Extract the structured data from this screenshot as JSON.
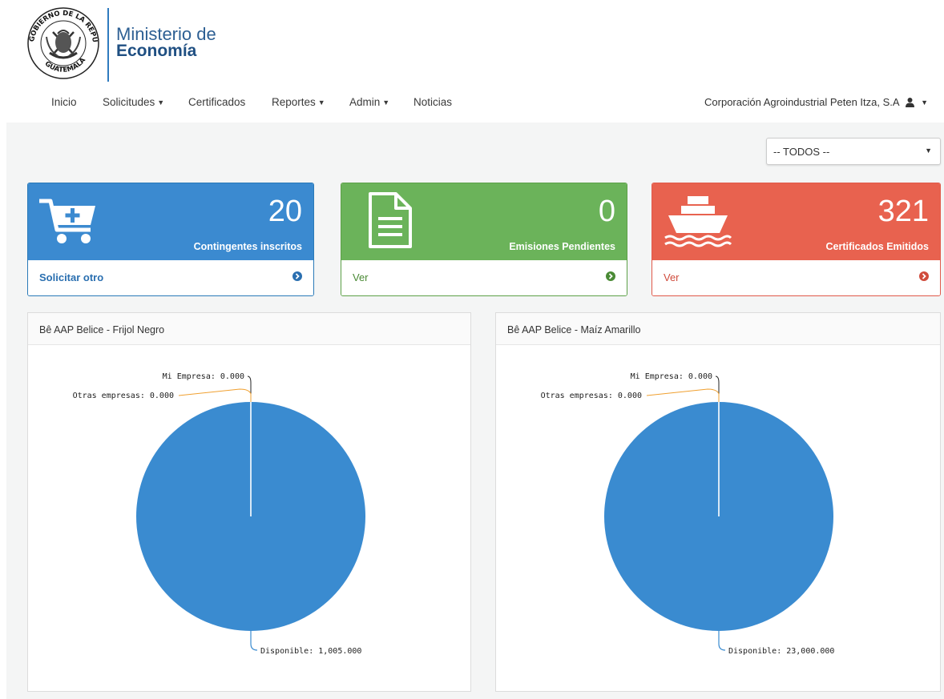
{
  "header": {
    "logo": {
      "seal_text": "GOBIERNO DE LA REPÚBLICA · GUATEMALA",
      "line1": "Ministerio de",
      "line2": "Economía"
    },
    "nav": [
      {
        "label": "Inicio",
        "has_caret": false
      },
      {
        "label": "Solicitudes",
        "has_caret": true
      },
      {
        "label": "Certificados",
        "has_caret": false
      },
      {
        "label": "Reportes",
        "has_caret": true
      },
      {
        "label": "Admin",
        "has_caret": true
      },
      {
        "label": "Noticias",
        "has_caret": false
      }
    ],
    "user": {
      "name": "Corporación Agroindustrial Peten Itza, S.A",
      "icon": "user-icon"
    }
  },
  "filter": {
    "selected": "-- TODOS --"
  },
  "cards": [
    {
      "value": "20",
      "label": "Contingentes inscritos",
      "link": "Solicitar otro",
      "icon": "cart-plus-icon",
      "color": "#3b8ad0"
    },
    {
      "value": "0",
      "label": "Emisiones Pendientes",
      "link": "Ver",
      "icon": "document-icon",
      "color": "#6bb35a"
    },
    {
      "value": "321",
      "label": "Certificados Emitidos",
      "link": "Ver",
      "icon": "ship-icon",
      "color": "#e8624f"
    }
  ],
  "colors": {
    "pie": "#3a8bd0",
    "disponible_line": "#3a8bd0",
    "otras_line": "#f0a030",
    "mi_line": "#222222"
  },
  "panels": [
    {
      "title": "Bê AAP Belice - Frijol Negro",
      "chart_data": {
        "type": "pie",
        "slices": [
          {
            "name": "Mi Empresa",
            "value": 0
          },
          {
            "name": "Otras empresas",
            "value": 0
          },
          {
            "name": "Disponible",
            "value": 1005000
          }
        ],
        "labels": [
          "Mi Empresa: 0.000",
          "Otras empresas: 0.000",
          "Disponible: 1,005.000"
        ]
      }
    },
    {
      "title": "Bê AAP Belice - Maíz Amarillo",
      "chart_data": {
        "type": "pie",
        "slices": [
          {
            "name": "Mi Empresa",
            "value": 0
          },
          {
            "name": "Otras empresas",
            "value": 0
          },
          {
            "name": "Disponible",
            "value": 23000000
          }
        ],
        "labels": [
          "Mi Empresa: 0.000",
          "Otras empresas: 0.000",
          "Disponible: 23,000.000"
        ]
      }
    }
  ]
}
